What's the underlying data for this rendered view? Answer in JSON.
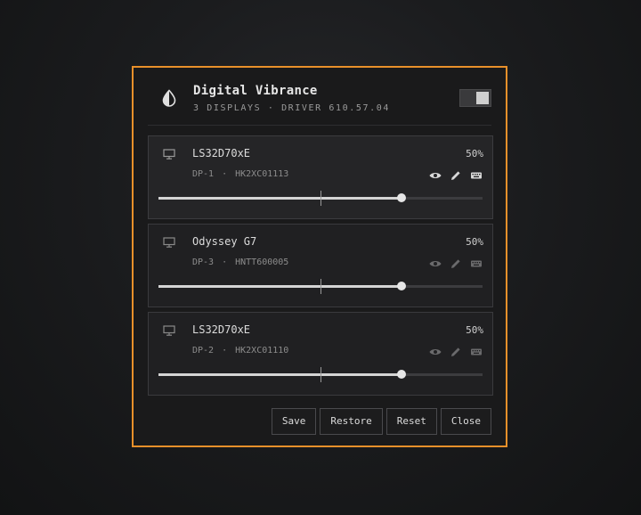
{
  "panel": {
    "accent_color": "#e8902a",
    "app_icon": "droplet-half-icon",
    "title": "Digital Vibrance",
    "subtitle": "3 DISPLAYS · DRIVER 610.57.04",
    "master_toggle_on": true
  },
  "displays": [
    {
      "name": "LS32D70xE",
      "value_label": "50%",
      "value": 0.75,
      "port": "DP-1",
      "separator": "·",
      "serial": "HK2XC01113",
      "icon": "monitor-icon",
      "active": true
    },
    {
      "name": "Odyssey G7",
      "value_label": "50%",
      "value": 0.75,
      "port": "DP-3",
      "separator": "·",
      "serial": "HNTT600005",
      "icon": "monitor-icon",
      "active": false
    },
    {
      "name": "LS32D70xE",
      "value_label": "50%",
      "value": 0.75,
      "port": "DP-2",
      "separator": "·",
      "serial": "HK2XC01110",
      "icon": "monitor-icon",
      "active": false
    }
  ],
  "actions": {
    "save": "Save",
    "restore": "Restore",
    "reset": "Reset",
    "close": "Close"
  }
}
